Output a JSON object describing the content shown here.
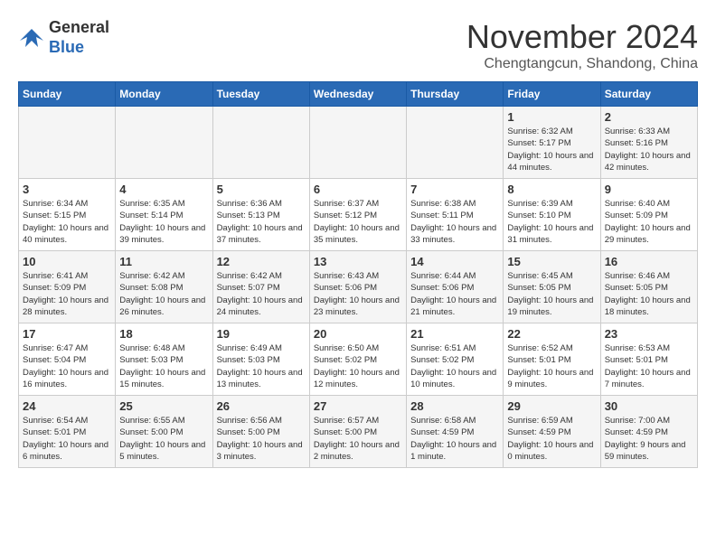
{
  "header": {
    "logo_line1": "General",
    "logo_line2": "Blue",
    "month": "November 2024",
    "location": "Chengtangcun, Shandong, China"
  },
  "days_of_week": [
    "Sunday",
    "Monday",
    "Tuesday",
    "Wednesday",
    "Thursday",
    "Friday",
    "Saturday"
  ],
  "weeks": [
    [
      {
        "day": "",
        "info": ""
      },
      {
        "day": "",
        "info": ""
      },
      {
        "day": "",
        "info": ""
      },
      {
        "day": "",
        "info": ""
      },
      {
        "day": "",
        "info": ""
      },
      {
        "day": "1",
        "info": "Sunrise: 6:32 AM\nSunset: 5:17 PM\nDaylight: 10 hours and 44 minutes."
      },
      {
        "day": "2",
        "info": "Sunrise: 6:33 AM\nSunset: 5:16 PM\nDaylight: 10 hours and 42 minutes."
      }
    ],
    [
      {
        "day": "3",
        "info": "Sunrise: 6:34 AM\nSunset: 5:15 PM\nDaylight: 10 hours and 40 minutes."
      },
      {
        "day": "4",
        "info": "Sunrise: 6:35 AM\nSunset: 5:14 PM\nDaylight: 10 hours and 39 minutes."
      },
      {
        "day": "5",
        "info": "Sunrise: 6:36 AM\nSunset: 5:13 PM\nDaylight: 10 hours and 37 minutes."
      },
      {
        "day": "6",
        "info": "Sunrise: 6:37 AM\nSunset: 5:12 PM\nDaylight: 10 hours and 35 minutes."
      },
      {
        "day": "7",
        "info": "Sunrise: 6:38 AM\nSunset: 5:11 PM\nDaylight: 10 hours and 33 minutes."
      },
      {
        "day": "8",
        "info": "Sunrise: 6:39 AM\nSunset: 5:10 PM\nDaylight: 10 hours and 31 minutes."
      },
      {
        "day": "9",
        "info": "Sunrise: 6:40 AM\nSunset: 5:09 PM\nDaylight: 10 hours and 29 minutes."
      }
    ],
    [
      {
        "day": "10",
        "info": "Sunrise: 6:41 AM\nSunset: 5:09 PM\nDaylight: 10 hours and 28 minutes."
      },
      {
        "day": "11",
        "info": "Sunrise: 6:42 AM\nSunset: 5:08 PM\nDaylight: 10 hours and 26 minutes."
      },
      {
        "day": "12",
        "info": "Sunrise: 6:42 AM\nSunset: 5:07 PM\nDaylight: 10 hours and 24 minutes."
      },
      {
        "day": "13",
        "info": "Sunrise: 6:43 AM\nSunset: 5:06 PM\nDaylight: 10 hours and 23 minutes."
      },
      {
        "day": "14",
        "info": "Sunrise: 6:44 AM\nSunset: 5:06 PM\nDaylight: 10 hours and 21 minutes."
      },
      {
        "day": "15",
        "info": "Sunrise: 6:45 AM\nSunset: 5:05 PM\nDaylight: 10 hours and 19 minutes."
      },
      {
        "day": "16",
        "info": "Sunrise: 6:46 AM\nSunset: 5:05 PM\nDaylight: 10 hours and 18 minutes."
      }
    ],
    [
      {
        "day": "17",
        "info": "Sunrise: 6:47 AM\nSunset: 5:04 PM\nDaylight: 10 hours and 16 minutes."
      },
      {
        "day": "18",
        "info": "Sunrise: 6:48 AM\nSunset: 5:03 PM\nDaylight: 10 hours and 15 minutes."
      },
      {
        "day": "19",
        "info": "Sunrise: 6:49 AM\nSunset: 5:03 PM\nDaylight: 10 hours and 13 minutes."
      },
      {
        "day": "20",
        "info": "Sunrise: 6:50 AM\nSunset: 5:02 PM\nDaylight: 10 hours and 12 minutes."
      },
      {
        "day": "21",
        "info": "Sunrise: 6:51 AM\nSunset: 5:02 PM\nDaylight: 10 hours and 10 minutes."
      },
      {
        "day": "22",
        "info": "Sunrise: 6:52 AM\nSunset: 5:01 PM\nDaylight: 10 hours and 9 minutes."
      },
      {
        "day": "23",
        "info": "Sunrise: 6:53 AM\nSunset: 5:01 PM\nDaylight: 10 hours and 7 minutes."
      }
    ],
    [
      {
        "day": "24",
        "info": "Sunrise: 6:54 AM\nSunset: 5:01 PM\nDaylight: 10 hours and 6 minutes."
      },
      {
        "day": "25",
        "info": "Sunrise: 6:55 AM\nSunset: 5:00 PM\nDaylight: 10 hours and 5 minutes."
      },
      {
        "day": "26",
        "info": "Sunrise: 6:56 AM\nSunset: 5:00 PM\nDaylight: 10 hours and 3 minutes."
      },
      {
        "day": "27",
        "info": "Sunrise: 6:57 AM\nSunset: 5:00 PM\nDaylight: 10 hours and 2 minutes."
      },
      {
        "day": "28",
        "info": "Sunrise: 6:58 AM\nSunset: 4:59 PM\nDaylight: 10 hours and 1 minute."
      },
      {
        "day": "29",
        "info": "Sunrise: 6:59 AM\nSunset: 4:59 PM\nDaylight: 10 hours and 0 minutes."
      },
      {
        "day": "30",
        "info": "Sunrise: 7:00 AM\nSunset: 4:59 PM\nDaylight: 9 hours and 59 minutes."
      }
    ]
  ]
}
